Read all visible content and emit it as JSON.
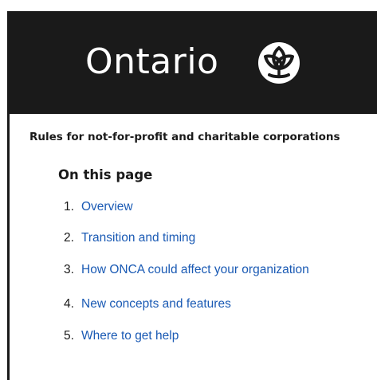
{
  "header": {
    "logo_text": "Ontario",
    "logo_icon": "trillium-logo-icon",
    "background_color": "#1a1a1a"
  },
  "page": {
    "heading": "Rules for not-for-profit and charitable corporations"
  },
  "toc": {
    "title": "On this page",
    "link_color": "#1a5ab4",
    "items": [
      {
        "number": "1.",
        "label": "Overview"
      },
      {
        "number": "2.",
        "label": "Transition and timing"
      },
      {
        "number": "3.",
        "label": "How ONCA could affect your organization"
      },
      {
        "number": "4.",
        "label": "New concepts and features"
      },
      {
        "number": "5.",
        "label": "Where to get help"
      }
    ]
  }
}
